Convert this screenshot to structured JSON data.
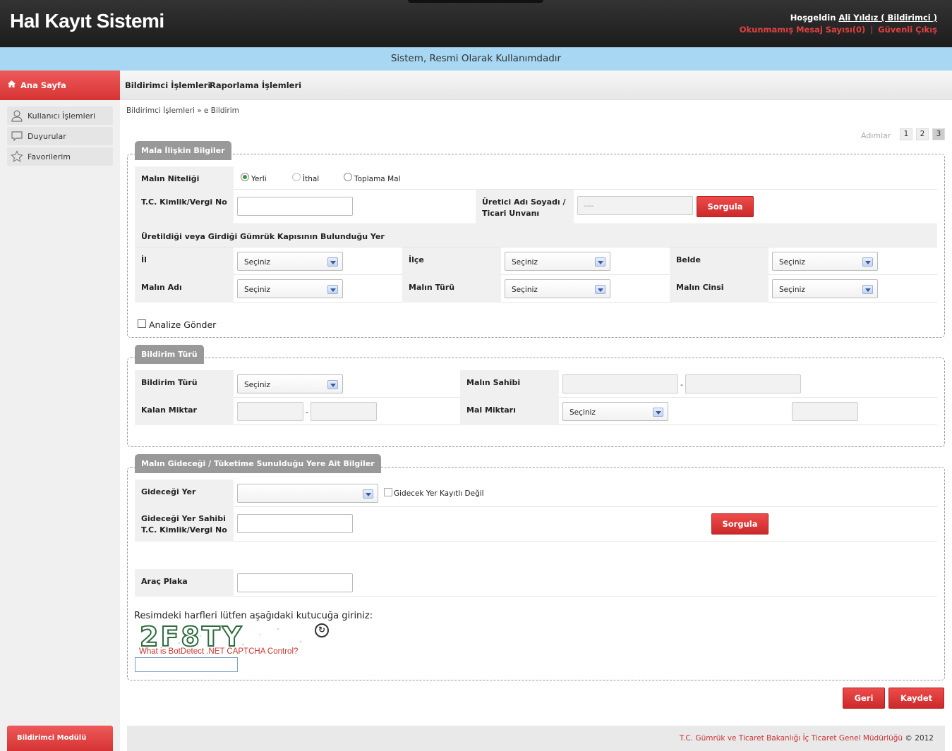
{
  "header": {
    "title": "Hal Kayıt Sistemi",
    "welcome_prefix": "Hoşgeldin",
    "user": "Ali Yıldız ( Bildirimci )",
    "messages_link": "Okunmamış Mesaj Sayısı(0)",
    "separator": "|",
    "logout_link": "Güvenli Çıkış"
  },
  "banner": "Sistem, Resmi Olarak Kullanımdadır",
  "nav": {
    "home": "Ana Sayfa",
    "items": [
      "Bildirimci İşlemleri",
      "Raporlama İşlemleri"
    ]
  },
  "sidebar": {
    "items": [
      {
        "label": "Kullanıcı İşlemleri",
        "icon": "user-icon"
      },
      {
        "label": "Duyurular",
        "icon": "speech-bubble-icon"
      },
      {
        "label": "Favorilerim",
        "icon": "star-icon"
      }
    ],
    "module": "Bildirimci Modülü"
  },
  "breadcrumb": "Bildirimci İşlemleri » e Bildirim",
  "steps": {
    "label": "Adımlar",
    "pages": [
      "1",
      "2",
      "3"
    ],
    "active": "3"
  },
  "section1": {
    "legend": "Mala İlişkin Bilgiler",
    "malin_niteligi": "Malın Niteliği",
    "radios": [
      "Yerli",
      "İthal",
      "Toplama Mal"
    ],
    "selected_radio": "Yerli",
    "tc_label": "T.C. Kimlik/Vergi No",
    "uretici_label_1": "Üretici Adı Soyadı /",
    "uretici_label_2": "Ticari Unvanı",
    "uretici_placeholder": "----",
    "sorgula": "Sorgula",
    "gumruk_header": "Üretildiği veya Girdiği Gümrük Kapısının Bulunduğu Yer",
    "il": "İl",
    "ilce": "İlçe",
    "belde": "Belde",
    "malin_adi": "Malın Adı",
    "malin_turu": "Malın Türü",
    "malin_cinsi": "Malın Cinsi",
    "select_default": "Seçiniz",
    "analize_gonder": "Analize Gönder"
  },
  "section2": {
    "legend": "Bildirim Türü",
    "bildirim_turu": "Bildirim Türü",
    "malin_sahibi": "Malın Sahibi",
    "kalan_miktar": "Kalan Miktar",
    "mal_miktari": "Mal Miktarı",
    "dash": "-",
    "select_default": "Seçiniz"
  },
  "section3": {
    "legend": "Malın Gideceği / Tüketime Sunulduğu Yere Ait Bilgiler",
    "gidecegi_yer": "Gideceği Yer",
    "kayitli_degil": "Gidecek Yer Kayıtlı Değil",
    "yer_sahibi_1": "Gideceği Yer Sahibi",
    "yer_sahibi_2": "T.C. Kimlik/Vergi No",
    "sorgula": "Sorgula",
    "arac_plaka": "Araç Plaka",
    "captcha_title": "Resimdeki harfleri lütfen aşağıdaki kutucuğa giriniz:",
    "captcha_text": "2F8TY",
    "captcha_link": "What is BotDetect .NET CAPTCHA Control?"
  },
  "actions": {
    "back": "Geri",
    "save": "Kaydet"
  },
  "footer": {
    "org": "T.C. Gümrük ve Ticaret Bakanlığı İç Ticaret Genel Müdürlüğü",
    "copyright": " © 2012"
  },
  "colors": {
    "accent_red": "#d63333",
    "banner_blue": "#a7d7f3",
    "header_dark": "#262626"
  }
}
